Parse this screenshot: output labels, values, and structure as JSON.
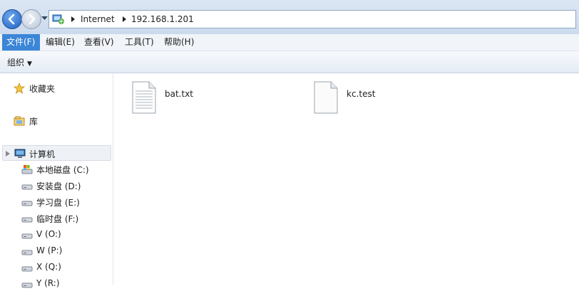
{
  "address": {
    "crumbs": [
      "Internet",
      "192.168.1.201"
    ]
  },
  "menu": {
    "items": [
      "文件(F)",
      "编辑(E)",
      "查看(V)",
      "工具(T)",
      "帮助(H)"
    ],
    "active_index": 0,
    "active_color": "#3b86d6"
  },
  "toolbar": {
    "organize_label": "组织"
  },
  "sidebar": {
    "favorites_label": "收藏夹",
    "libraries_label": "库",
    "computer_label": "计算机",
    "drives": [
      "本地磁盘 (C:)",
      "安装盘 (D:)",
      "学习盘 (E:)",
      "临时盘 (F:)",
      "V (O:)",
      "W (P:)",
      "X (Q:)",
      "Y (R:)"
    ]
  },
  "files": [
    {
      "name": "bat.txt",
      "icon": "text-file-icon"
    },
    {
      "name": "kc.test",
      "icon": "generic-file-icon"
    }
  ]
}
